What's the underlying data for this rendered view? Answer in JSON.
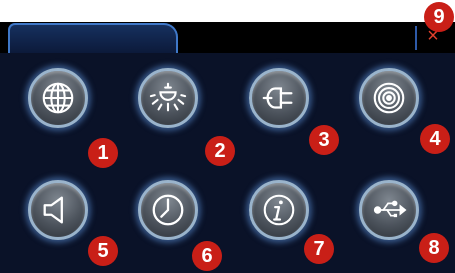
{
  "colors": {
    "panel": "#0a1228",
    "accent": "#3f78c8",
    "badge": "#c91f17",
    "close": "#e0402c"
  },
  "close": {
    "symbol": "×",
    "icon": "close-icon"
  },
  "buttons": [
    {
      "icon": "globe-icon",
      "badge": "1"
    },
    {
      "icon": "light-bulb-icon",
      "badge": "2"
    },
    {
      "icon": "power-plug-icon",
      "badge": "3"
    },
    {
      "icon": "target-icon",
      "badge": "4"
    },
    {
      "icon": "speaker-icon",
      "badge": "5"
    },
    {
      "icon": "clock-icon",
      "badge": "6"
    },
    {
      "icon": "info-icon",
      "badge": "7"
    },
    {
      "icon": "usb-icon",
      "badge": "8"
    }
  ],
  "close_badge": "9"
}
